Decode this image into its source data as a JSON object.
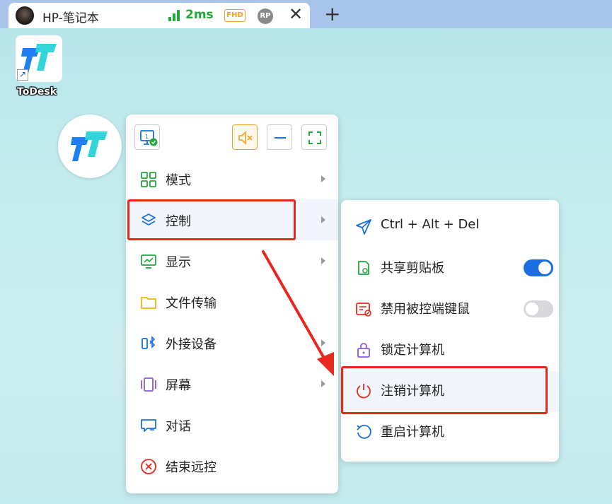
{
  "tab": {
    "title": "HP-笔记本",
    "ping": "2ms",
    "quality_badge": "FHD",
    "rp_badge": "RP",
    "close_glyph": "✕",
    "add_glyph": "+"
  },
  "desktop": {
    "icon_label": "ToDesk"
  },
  "menu": {
    "items": [
      {
        "label": "模式",
        "icon": "grid-icon",
        "has_submenu": true
      },
      {
        "label": "控制",
        "icon": "layers-icon",
        "has_submenu": true
      },
      {
        "label": "显示",
        "icon": "monitor-icon",
        "has_submenu": true
      },
      {
        "label": "文件传输",
        "icon": "folder-icon",
        "has_submenu": false
      },
      {
        "label": "外接设备",
        "icon": "bluetooth-device-icon",
        "has_submenu": true
      },
      {
        "label": "屏幕",
        "icon": "screens-icon",
        "has_submenu": true
      },
      {
        "label": "对话",
        "icon": "chat-icon",
        "has_submenu": false
      },
      {
        "label": "结束远控",
        "icon": "close-circle-icon",
        "has_submenu": false
      }
    ]
  },
  "submenu": {
    "items": [
      {
        "label": "Ctrl + Alt + Del",
        "icon": "send-icon"
      },
      {
        "label": "共享剪贴板",
        "icon": "clipboard-share-icon",
        "toggle": true
      },
      {
        "label": "禁用被控端键鼠",
        "icon": "keyboard-disable-icon",
        "toggle": false
      },
      {
        "label": "锁定计算机",
        "icon": "lock-icon"
      },
      {
        "label": "注销计算机",
        "icon": "power-icon"
      },
      {
        "label": "重启计算机",
        "icon": "restart-icon"
      }
    ]
  },
  "colors": {
    "accent": "#1a6fe0",
    "highlight": "#e8281e",
    "signal": "#22a83a"
  }
}
